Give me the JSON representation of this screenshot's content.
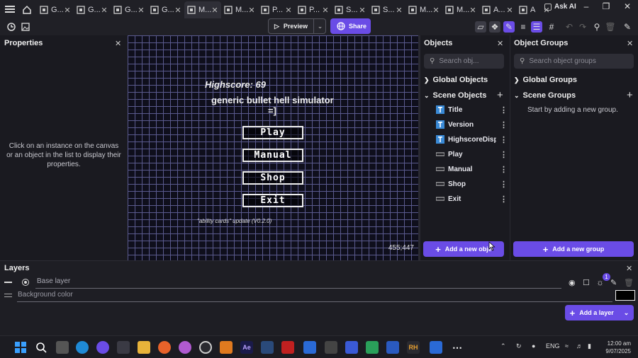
{
  "tabs": [
    {
      "label": "G...",
      "active": false
    },
    {
      "label": "G...",
      "active": false
    },
    {
      "label": "G...",
      "active": false
    },
    {
      "label": "G...",
      "active": false
    },
    {
      "label": "M...",
      "active": true
    },
    {
      "label": "M...",
      "active": false
    },
    {
      "label": "P...",
      "active": false
    },
    {
      "label": "P...",
      "active": false
    },
    {
      "label": "S...",
      "active": false
    },
    {
      "label": "S...",
      "active": false
    },
    {
      "label": "M...",
      "active": false
    },
    {
      "label": "M...",
      "active": false
    },
    {
      "label": "A...",
      "active": false
    },
    {
      "label": "A",
      "active": false
    }
  ],
  "ask_ai": "Ask AI",
  "toolbar": {
    "preview_label": "Preview",
    "share_label": "Share"
  },
  "properties": {
    "title": "Properties",
    "hint": "Click on an instance on the canvas or an object in the list to display their properties."
  },
  "game": {
    "highscore": "Highscore: 69",
    "title_line1": "generic bullet hell simulator",
    "title_line2": "=]",
    "buttons": [
      "Play",
      "Manual",
      "Shop",
      "Exit"
    ],
    "version": "\"ability cards\" update (V0.2.0)"
  },
  "canvas_coords": "455;447",
  "objects_panel": {
    "title": "Objects",
    "search_placeholder": "Search obj...",
    "global_label": "Global Objects",
    "scene_label": "Scene Objects",
    "items": [
      {
        "name": "Title",
        "icon": "text-object-icon"
      },
      {
        "name": "Version",
        "icon": "text-object-icon"
      },
      {
        "name": "HighscoreDisp...",
        "icon": "text-object-icon"
      },
      {
        "name": "Play",
        "icon": "button-object-icon"
      },
      {
        "name": "Manual",
        "icon": "button-object-icon"
      },
      {
        "name": "Shop",
        "icon": "button-object-icon"
      },
      {
        "name": "Exit",
        "icon": "button-object-icon"
      }
    ],
    "add_label": "Add a new obje"
  },
  "groups_panel": {
    "title": "Object Groups",
    "search_placeholder": "Search object groups",
    "global_label": "Global Groups",
    "scene_label": "Scene Groups",
    "empty_hint": "Start by adding a new group.",
    "add_label": "Add a new group"
  },
  "layers_panel": {
    "title": "Layers",
    "base_layer": "Base layer",
    "background": "Background color",
    "add_label": "Add a layer",
    "badge": "1"
  },
  "taskbar": {
    "lang": "ENG",
    "time": "12:00 am",
    "date": "9/07/2025",
    "app_labels": {
      "ae": "Ae",
      "rh": "RH"
    }
  },
  "colors": {
    "accent": "#6a4ce6",
    "panel": "#1a1a20",
    "canvas_grid": "#5a5a8e"
  }
}
